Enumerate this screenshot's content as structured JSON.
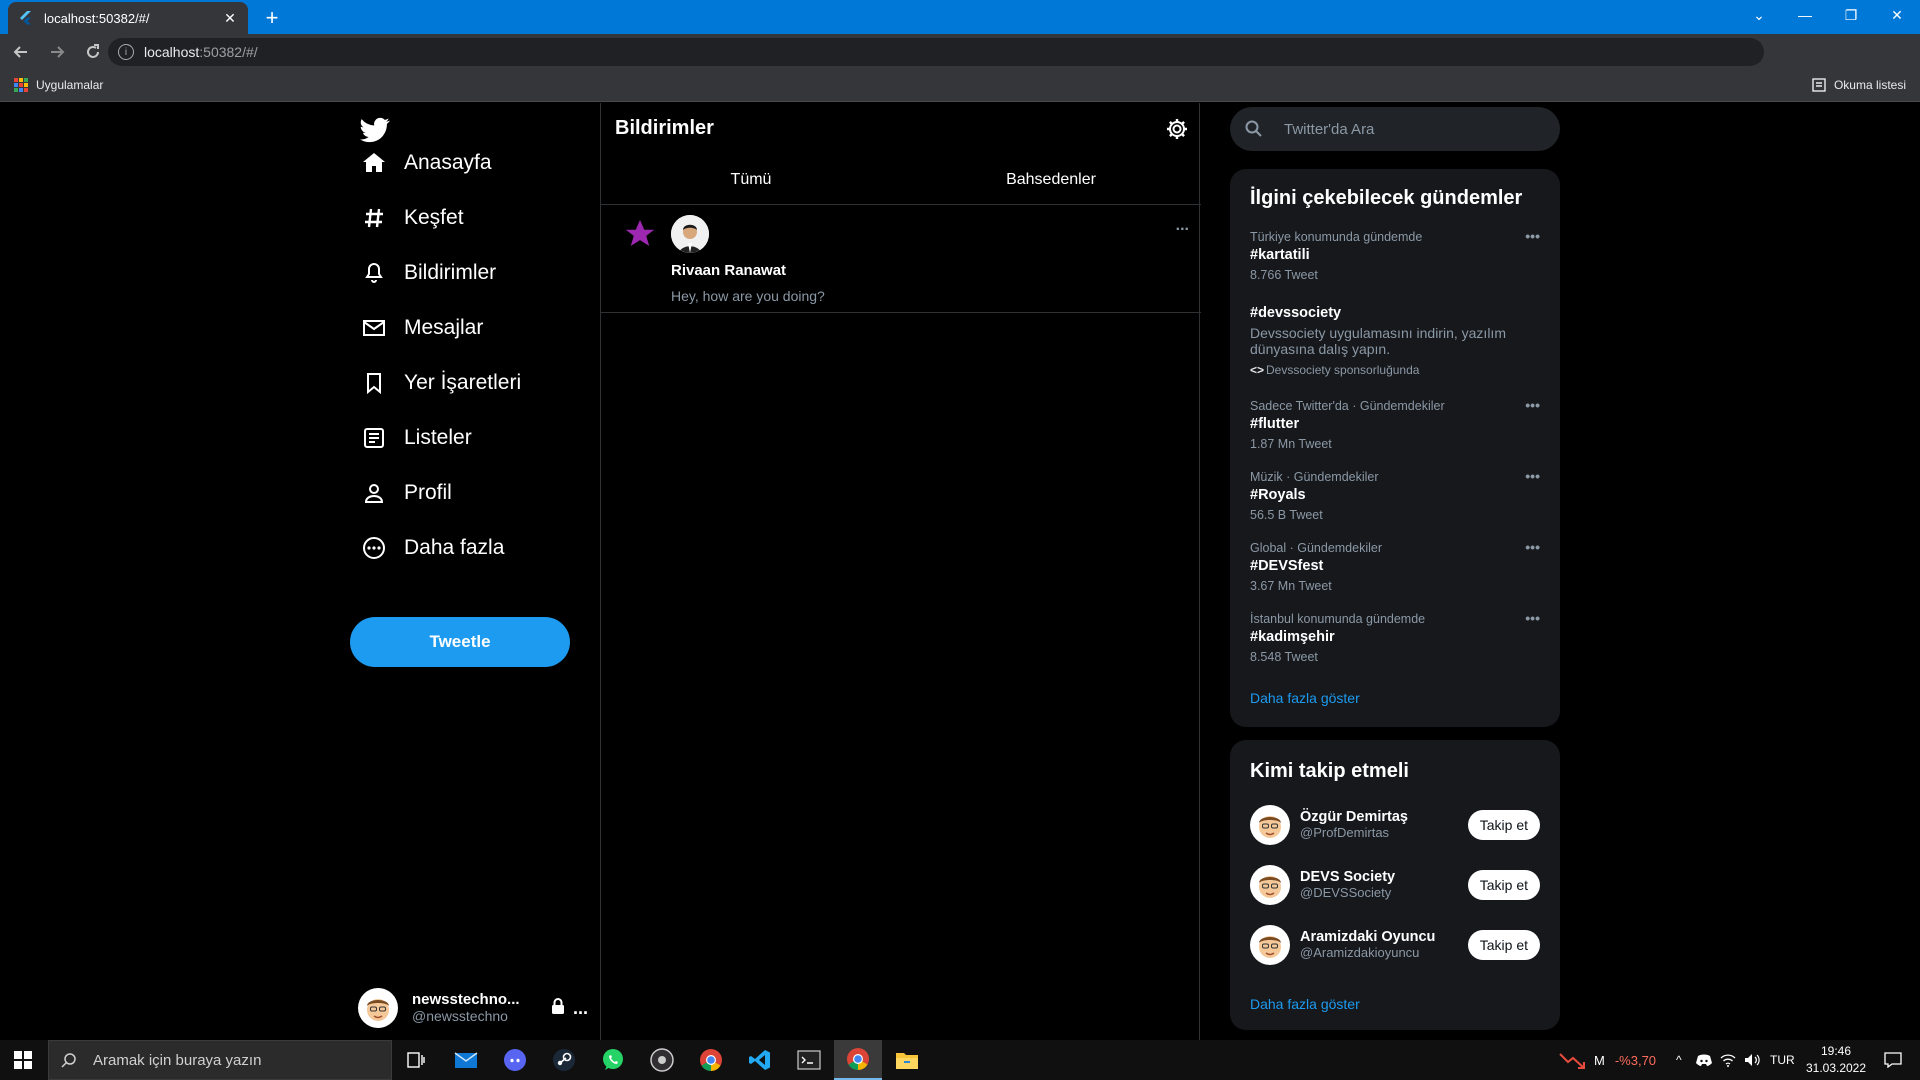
{
  "browser": {
    "tab_title": "localhost:50382/#/",
    "url_host": "localhost",
    "url_path": ":50382/#/",
    "bookmarks_apps": "Uygulamalar",
    "reading_list": "Okuma listesi"
  },
  "sidebar": {
    "items": [
      {
        "label": "Anasayfa",
        "icon": "home-icon"
      },
      {
        "label": "Keşfet",
        "icon": "hashtag-icon"
      },
      {
        "label": "Bildirimler",
        "icon": "bell-icon"
      },
      {
        "label": "Mesajlar",
        "icon": "mail-icon"
      },
      {
        "label": "Yer İşaretleri",
        "icon": "bookmark-icon"
      },
      {
        "label": "Listeler",
        "icon": "list-icon"
      },
      {
        "label": "Profil",
        "icon": "person-icon"
      },
      {
        "label": "Daha fazla",
        "icon": "more-circle-icon"
      }
    ],
    "tweet_button": "Tweetle",
    "account": {
      "name": "newsstechno...",
      "handle": "@newsstechno",
      "more": "..."
    }
  },
  "main": {
    "title": "Bildirimler",
    "tabs": [
      {
        "label": "Tümü"
      },
      {
        "label": "Bahsedenler"
      }
    ],
    "notification": {
      "name": "Rivaan Ranawat",
      "text": "Hey, how are you doing?",
      "more": "..."
    }
  },
  "search": {
    "placeholder": "Twitter'da Ara"
  },
  "trends": {
    "title": "İlgini çekebilecek gündemler",
    "items": [
      {
        "context": "Türkiye konumunda gündemde",
        "tag": "#kartatili",
        "count": "8.766 Tweet"
      },
      {
        "tag": "#devssociety",
        "description": "Devssociety uygulamasını indirin, yazılım dünyasına dalış yapın.",
        "sponsor": "Devssociety sponsorluğunda"
      },
      {
        "context": "Sadece Twitter'da · Gündemdekiler",
        "tag": "#flutter",
        "count": "1.87 Mn Tweet"
      },
      {
        "context": "Müzik · Gündemdekiler",
        "tag": "#Royals",
        "count": "56.5 B Tweet"
      },
      {
        "context": "Global · Gündemdekiler",
        "tag": "#DEVSfest",
        "count": "3.67 Mn Tweet"
      },
      {
        "context": "İstanbul konumunda gündemde",
        "tag": "#kadimşehir",
        "count": "8.548 Tweet"
      }
    ],
    "show_more": "Daha fazla göster",
    "dots": "•••"
  },
  "who_to_follow": {
    "title": "Kimi takip etmeli",
    "users": [
      {
        "name": "Özgür Demirtaş",
        "handle": "@ProfDemirtas",
        "button": "Takip et"
      },
      {
        "name": "DEVS Society",
        "handle": "@DEVSSociety",
        "button": "Takip et"
      },
      {
        "name": "Aramizdaki Oyuncu",
        "handle": "@Aramizdakioyuncu",
        "button": "Takip et"
      }
    ],
    "show_more": "Daha fazla göster"
  },
  "taskbar": {
    "search_placeholder": "Aramak için buraya yazın",
    "stock_symbol": "M",
    "stock_change": "-%3,70",
    "language": "TUR",
    "time": "19:46",
    "date": "31.03.2022"
  },
  "colors": {
    "accent": "#1d9bf0",
    "star": "#9c27b0",
    "titlebar": "#0078d7"
  }
}
